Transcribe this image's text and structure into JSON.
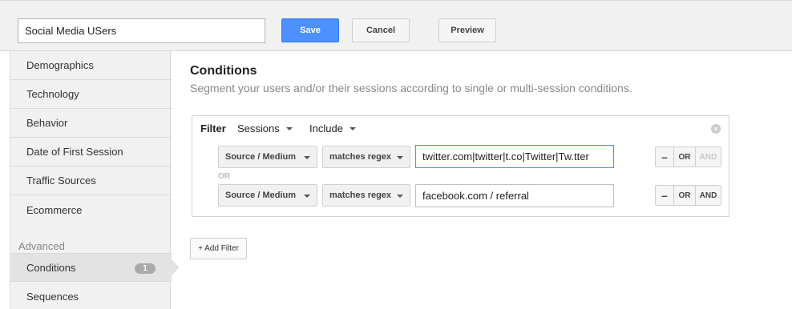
{
  "header": {
    "segment_name": "Social Media USers",
    "save_label": "Save",
    "cancel_label": "Cancel",
    "preview_label": "Preview"
  },
  "sidebar": {
    "items": [
      {
        "label": "Demographics"
      },
      {
        "label": "Technology"
      },
      {
        "label": "Behavior"
      },
      {
        "label": "Date of First Session"
      },
      {
        "label": "Traffic Sources"
      },
      {
        "label": "Ecommerce"
      }
    ],
    "advanced_label": "Advanced",
    "advanced_items": [
      {
        "label": "Conditions",
        "badge": "1"
      },
      {
        "label": "Sequences"
      }
    ]
  },
  "main": {
    "title": "Conditions",
    "subtitle": "Segment your users and/or their sessions according to single or multi-session conditions."
  },
  "filter": {
    "label": "Filter",
    "scope": "Sessions",
    "mode": "Include",
    "rows": [
      {
        "dimension": "Source / Medium",
        "operator": "matches regex",
        "value": "twitter.com|twitter|t.co|Twitter|Tw.tter"
      },
      {
        "dimension": "Source / Medium",
        "operator": "matches regex",
        "value": "facebook.com / referral"
      }
    ],
    "or_separator": "OR",
    "minus_label": "–",
    "or_label": "OR",
    "and_label": "AND",
    "add_filter_label": "+ Add Filter"
  }
}
